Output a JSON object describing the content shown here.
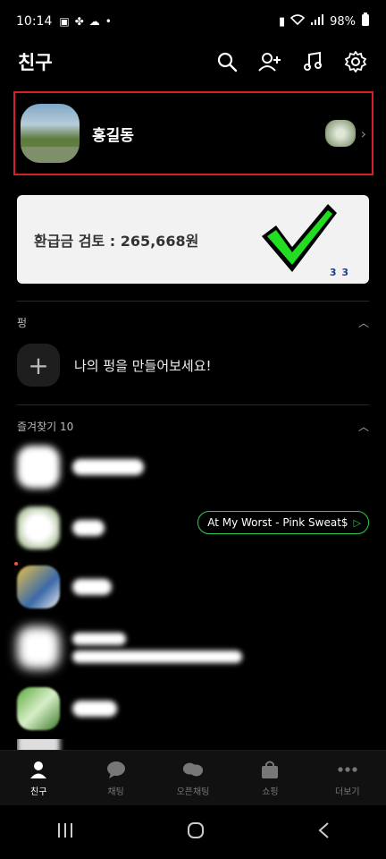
{
  "status_bar": {
    "time": "10:14",
    "battery": "98%"
  },
  "header": {
    "title": "친구"
  },
  "profile": {
    "name": "홍길동"
  },
  "banner": {
    "text": "환급금 검토 : 265,668원",
    "badge": "3 3"
  },
  "sections": [
    {
      "title": "펑"
    },
    {
      "title": "즐겨찾기 10"
    }
  ],
  "add_pung": {
    "text": "나의 펑을 만들어보세요!"
  },
  "favorites": {
    "music_label": "At My Worst - Pink Sweat$"
  },
  "bottom_nav": [
    {
      "label": "친구"
    },
    {
      "label": "채팅"
    },
    {
      "label": "오픈채팅"
    },
    {
      "label": "쇼핑"
    },
    {
      "label": "더보기"
    }
  ]
}
